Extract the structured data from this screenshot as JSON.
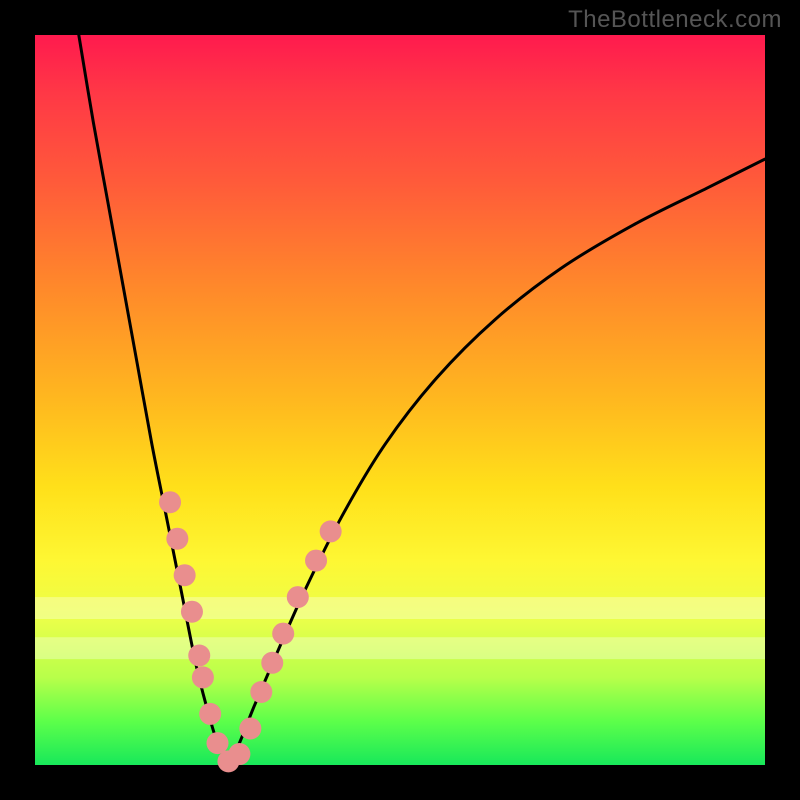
{
  "watermark": "TheBottleneck.com",
  "chart_data": {
    "type": "line",
    "title": "",
    "xlabel": "",
    "ylabel": "",
    "xlim": [
      0,
      100
    ],
    "ylim": [
      0,
      100
    ],
    "grid": false,
    "legend": false,
    "series": [
      {
        "name": "left-branch",
        "color": "#000000",
        "stroke_width": 3,
        "x": [
          6,
          8,
          10,
          12,
          14,
          16,
          18,
          20,
          22,
          23.5,
          25,
          26.5
        ],
        "y": [
          100,
          88,
          77,
          66,
          55,
          44,
          34,
          24,
          14,
          8,
          3,
          0
        ]
      },
      {
        "name": "right-branch",
        "color": "#000000",
        "stroke_width": 3,
        "x": [
          26.5,
          28,
          30,
          33,
          37,
          42,
          48,
          55,
          63,
          72,
          82,
          92,
          100
        ],
        "y": [
          0,
          3,
          8,
          15,
          24,
          34,
          44,
          53,
          61,
          68,
          74,
          79,
          83
        ]
      }
    ],
    "scatter": {
      "name": "dots",
      "color": "#e98e8e",
      "radius": 11,
      "points": [
        {
          "x": 18.5,
          "y": 36
        },
        {
          "x": 19.5,
          "y": 31
        },
        {
          "x": 20.5,
          "y": 26
        },
        {
          "x": 21.5,
          "y": 21
        },
        {
          "x": 22.5,
          "y": 15
        },
        {
          "x": 23.0,
          "y": 12
        },
        {
          "x": 24.0,
          "y": 7
        },
        {
          "x": 25.0,
          "y": 3
        },
        {
          "x": 26.5,
          "y": 0.5
        },
        {
          "x": 28.0,
          "y": 1.5
        },
        {
          "x": 29.5,
          "y": 5
        },
        {
          "x": 31.0,
          "y": 10
        },
        {
          "x": 32.5,
          "y": 14
        },
        {
          "x": 34.0,
          "y": 18
        },
        {
          "x": 36.0,
          "y": 23
        },
        {
          "x": 38.5,
          "y": 28
        },
        {
          "x": 40.5,
          "y": 32
        }
      ]
    },
    "pale_bands_y": [
      {
        "from": 20,
        "to": 23
      },
      {
        "from": 14.5,
        "to": 17.5
      }
    ]
  }
}
